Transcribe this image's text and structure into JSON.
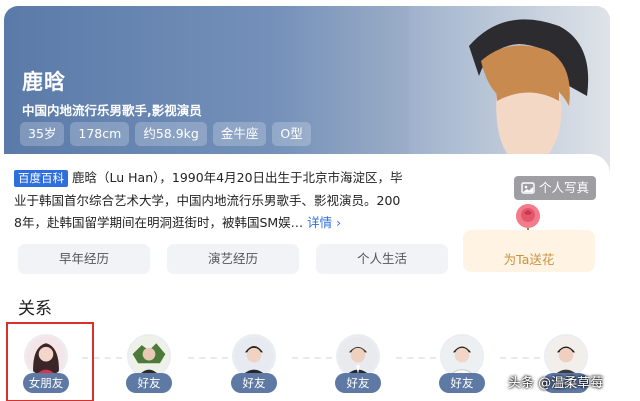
{
  "profile": {
    "name": "鹿晗",
    "subtitle": "中国内地流行乐男歌手,影视演员",
    "tags": [
      "35岁",
      "178cm",
      "约58.9kg",
      "金牛座",
      "O型"
    ],
    "photo_button": "个人写真"
  },
  "description": {
    "badge": "百度百科",
    "line1": "鹿晗（Lu Han），1990年4月20日出生于北京市海淀区，毕",
    "line2": "业于韩国首尔综合艺术大学，中国内地流行乐男歌手、影视演员。200",
    "line3": "8年，赴韩国留学期间在明洞逛街时，被韩国SM娱…",
    "more": "详情 ›"
  },
  "tabs": [
    "早年经历",
    "演艺经历",
    "个人生活"
  ],
  "flower_button": "为Ta送花",
  "relations": {
    "title": "关系",
    "people": [
      {
        "label": "女朋友"
      },
      {
        "label": "好友"
      },
      {
        "label": "好友"
      },
      {
        "label": "好友"
      },
      {
        "label": "好友"
      },
      {
        "label": "好友"
      }
    ]
  },
  "watermark": "头条 @温柔草莓",
  "colors": {
    "accent": "#2f6fdd",
    "hero": "#6b88b3",
    "label": "#5e79a4",
    "highlight": "#d9302c"
  }
}
